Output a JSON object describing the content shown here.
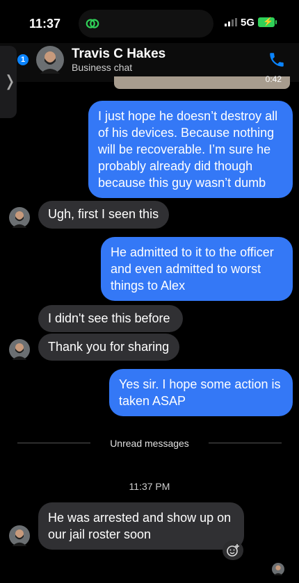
{
  "status_bar": {
    "time": "11:37",
    "network": "5G"
  },
  "header": {
    "name": "Travis C Hakes",
    "subtitle": "Business chat",
    "unread_badge": "1"
  },
  "previous_media": {
    "duration": "0:42"
  },
  "messages": [
    {
      "direction": "out",
      "text": "I just hope he doesn’t destroy all of his devices. Because nothing will be recoverable. I’m sure he probably already did though because this guy wasn’t dumb"
    },
    {
      "direction": "in",
      "text": "Ugh, first I seen this"
    },
    {
      "direction": "out",
      "text": "He admitted to it to the officer and even admitted to worst things to Alex"
    },
    {
      "direction": "in",
      "text": "I didn't see this before"
    },
    {
      "direction": "in",
      "text": "Thank you for sharing"
    },
    {
      "direction": "out",
      "text": "Yes sir. I hope some action is taken ASAP"
    },
    {
      "direction": "in",
      "text": "He was arrested and show up on our jail roster soon"
    }
  ],
  "divider": {
    "label": "Unread messages"
  },
  "timestamp": "11:37 PM",
  "colors": {
    "outgoing": "#3478f6",
    "incoming": "#303033",
    "accent": "#0a84ff",
    "battery": "#30d158"
  },
  "icons": [
    "link-icon",
    "signal-icon",
    "battery-charging-icon",
    "back-chevron-icon",
    "phone-icon",
    "add-reaction-icon"
  ]
}
